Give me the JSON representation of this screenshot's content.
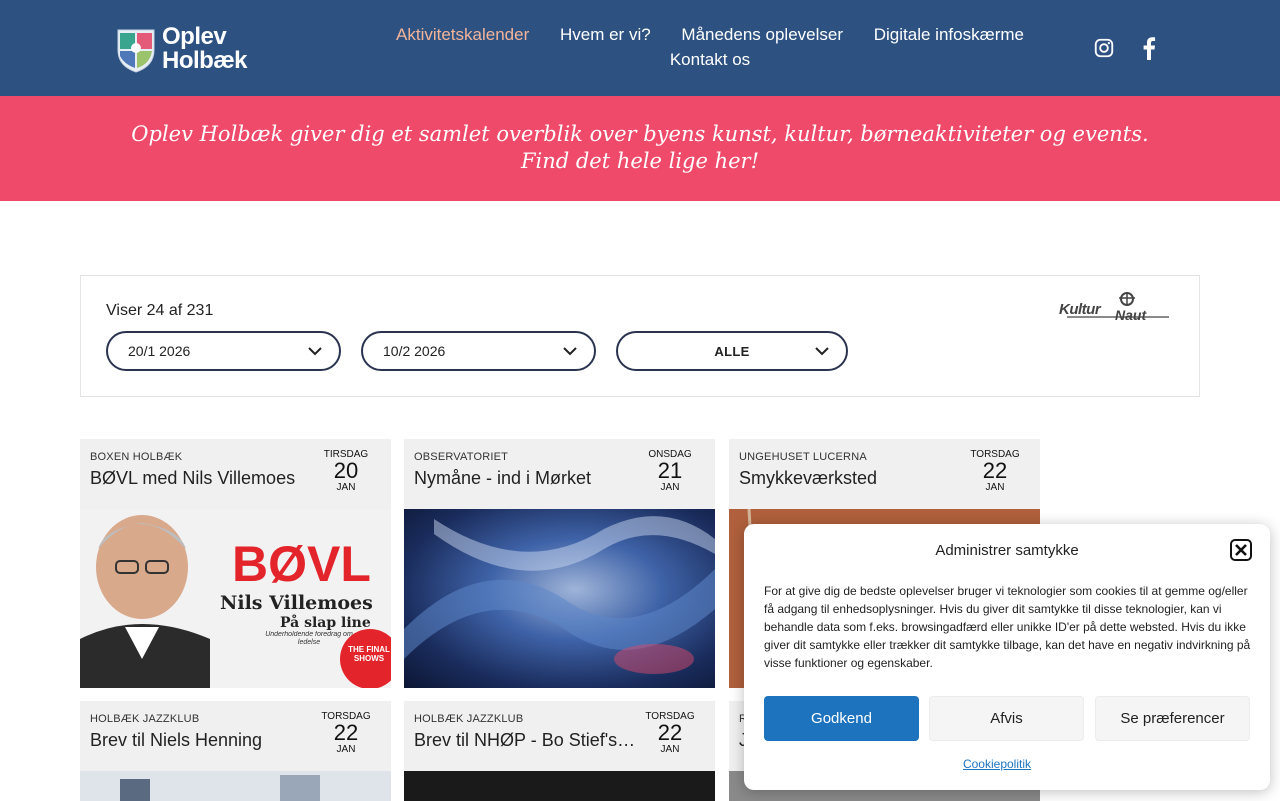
{
  "header": {
    "logo_line1": "Oplev",
    "logo_line2": "Holbæk",
    "nav": [
      {
        "label": "Aktivitetskalender",
        "active": true
      },
      {
        "label": "Hvem er vi?",
        "active": false
      },
      {
        "label": "Månedens oplevelser",
        "active": false
      },
      {
        "label": "Digitale infoskærme",
        "active": false
      },
      {
        "label": "Kontakt os",
        "active": false
      }
    ],
    "social": [
      "instagram-icon",
      "facebook-icon"
    ]
  },
  "banner": {
    "line1": "Oplev Holbæk giver dig et samlet overblik over byens kunst, kultur, børneaktiviteter og events.",
    "line2": "Find det hele lige her!"
  },
  "filters": {
    "showing": "Viser 24 af 231",
    "from_date": "20/1 2026",
    "to_date": "10/2 2026",
    "category": "ALLE",
    "brand_logo_text": "KulturNaut"
  },
  "events": [
    {
      "venue": "BOXEN HOLBÆK",
      "title": "BØVL med Nils Villemoes",
      "dow": "TIRSDAG",
      "day": "20",
      "month": "JAN"
    },
    {
      "venue": "OBSERVATORIET",
      "title": "Nymåne - ind i Mørket",
      "dow": "ONSDAG",
      "day": "21",
      "month": "JAN"
    },
    {
      "venue": "UNGEHUSET LUCERNA",
      "title": "Smykkeværksted",
      "dow": "TORSDAG",
      "day": "22",
      "month": "JAN"
    },
    {
      "venue": "HOLBÆK JAZZKLUB",
      "title": "Brev til Niels Henning",
      "dow": "TORSDAG",
      "day": "22",
      "month": "JAN"
    },
    {
      "venue": "HOLBÆK JAZZKLUB",
      "title": "Brev til NHØP - Bo Stief's kvartet",
      "dow": "TORSDAG",
      "day": "22",
      "month": "JAN"
    },
    {
      "venue": "R",
      "title": "J",
      "dow": "",
      "day": "",
      "month": ""
    }
  ],
  "poster": {
    "title": "BØVL",
    "name": "Nils Villemoes",
    "subtitle": "På slap line",
    "tagline": "Underholdende foredrag om ledelse",
    "badge": "THE FINAL SHOWS"
  },
  "cookie": {
    "title": "Administrer samtykke",
    "text": "For at give dig de bedste oplevelser bruger vi teknologier som cookies til at gemme og/eller få adgang til enhedsoplysninger. Hvis du giver dit samtykke til disse teknologier, kan vi behandle data som f.eks. browsingadfærd eller unikke ID'er på dette websted. Hvis du ikke giver dit samtykke eller trækker dit samtykke tilbage, kan det have en negativ indvirkning på visse funktioner og egenskaber.",
    "accept": "Godkend",
    "deny": "Afvis",
    "preferences": "Se præferencer",
    "policy_link": "Cookiepolitik"
  },
  "colors": {
    "header_bg": "#2d5282",
    "nav_active": "#f3b49a",
    "banner_bg": "#ef4a6a",
    "primary_button": "#1e73be"
  }
}
